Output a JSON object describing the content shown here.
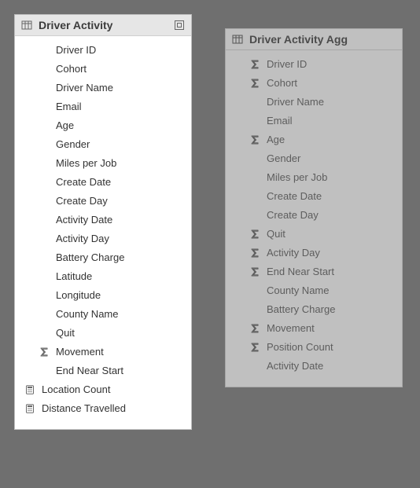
{
  "panels": [
    {
      "title": "Driver Activity",
      "dimmed": false,
      "tailIcon": "group-icon",
      "fields": [
        {
          "label": "Driver ID",
          "icon": null,
          "indent": 1
        },
        {
          "label": "Cohort",
          "icon": null,
          "indent": 1
        },
        {
          "label": "Driver Name",
          "icon": null,
          "indent": 1
        },
        {
          "label": "Email",
          "icon": null,
          "indent": 1
        },
        {
          "label": "Age",
          "icon": null,
          "indent": 1
        },
        {
          "label": "Gender",
          "icon": null,
          "indent": 1
        },
        {
          "label": "Miles per Job",
          "icon": null,
          "indent": 1
        },
        {
          "label": "Create Date",
          "icon": null,
          "indent": 1
        },
        {
          "label": "Create Day",
          "icon": null,
          "indent": 1
        },
        {
          "label": "Activity Date",
          "icon": null,
          "indent": 1
        },
        {
          "label": "Activity Day",
          "icon": null,
          "indent": 1
        },
        {
          "label": "Battery Charge",
          "icon": null,
          "indent": 1
        },
        {
          "label": "Latitude",
          "icon": null,
          "indent": 1
        },
        {
          "label": "Longitude",
          "icon": null,
          "indent": 1
        },
        {
          "label": "County Name",
          "icon": null,
          "indent": 1
        },
        {
          "label": "Quit",
          "icon": null,
          "indent": 1
        },
        {
          "label": "Movement",
          "icon": "sigma",
          "indent": 1
        },
        {
          "label": "End Near Start",
          "icon": null,
          "indent": 1
        },
        {
          "label": "Location Count",
          "icon": "calc",
          "indent": 0
        },
        {
          "label": "Distance Travelled",
          "icon": "calc",
          "indent": 0
        }
      ]
    },
    {
      "title": "Driver Activity Agg",
      "dimmed": true,
      "tailIcon": null,
      "fields": [
        {
          "label": "Driver ID",
          "icon": "sigma",
          "indent": 1
        },
        {
          "label": "Cohort",
          "icon": "sigma",
          "indent": 1
        },
        {
          "label": "Driver Name",
          "icon": null,
          "indent": 1
        },
        {
          "label": "Email",
          "icon": null,
          "indent": 1
        },
        {
          "label": "Age",
          "icon": "sigma",
          "indent": 1
        },
        {
          "label": "Gender",
          "icon": null,
          "indent": 1
        },
        {
          "label": "Miles per Job",
          "icon": null,
          "indent": 1
        },
        {
          "label": "Create Date",
          "icon": null,
          "indent": 1
        },
        {
          "label": "Create Day",
          "icon": null,
          "indent": 1
        },
        {
          "label": "Quit",
          "icon": "sigma",
          "indent": 1
        },
        {
          "label": "Activity Day",
          "icon": "sigma",
          "indent": 1
        },
        {
          "label": "End Near Start",
          "icon": "sigma",
          "indent": 1
        },
        {
          "label": "County Name",
          "icon": null,
          "indent": 1
        },
        {
          "label": "Battery Charge",
          "icon": null,
          "indent": 1
        },
        {
          "label": "Movement",
          "icon": "sigma",
          "indent": 1
        },
        {
          "label": "Position Count",
          "icon": "sigma",
          "indent": 1
        },
        {
          "label": "Activity Date",
          "icon": null,
          "indent": 1
        }
      ]
    }
  ]
}
